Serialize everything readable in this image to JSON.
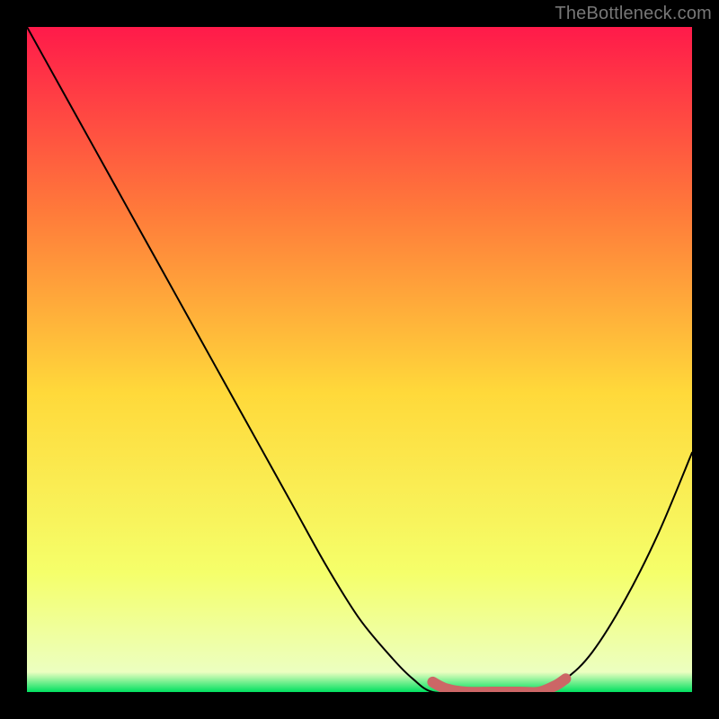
{
  "watermark": "TheBottleneck.com",
  "chart_data": {
    "type": "line",
    "title": "",
    "xlabel": "",
    "ylabel": "",
    "xlim": [
      0,
      1
    ],
    "ylim": [
      0,
      1
    ],
    "legend": false,
    "grid": false,
    "background_gradient": {
      "top": "#ff1a4a",
      "mid_upper": "#ff7b3a",
      "mid": "#ffd93a",
      "mid_lower": "#f5ff6a",
      "bottom": "#00e060"
    },
    "series": [
      {
        "name": "curve",
        "color": "#000000",
        "x": [
          0.0,
          0.05,
          0.1,
          0.15,
          0.2,
          0.25,
          0.3,
          0.35,
          0.4,
          0.45,
          0.5,
          0.55,
          0.58,
          0.61,
          0.66,
          0.72,
          0.77,
          0.81,
          0.85,
          0.9,
          0.95,
          1.0
        ],
        "y": [
          1.0,
          0.91,
          0.82,
          0.73,
          0.64,
          0.55,
          0.46,
          0.37,
          0.28,
          0.19,
          0.11,
          0.05,
          0.02,
          0.0,
          0.0,
          0.0,
          0.0,
          0.02,
          0.06,
          0.14,
          0.24,
          0.36
        ]
      }
    ],
    "highlight_segments": [
      {
        "name": "red-flat-segment",
        "color": "#cc6666",
        "x": [
          0.61,
          0.63,
          0.66,
          0.7,
          0.74,
          0.77,
          0.795,
          0.81
        ],
        "y": [
          0.015,
          0.005,
          0.0,
          0.0,
          0.0,
          0.0,
          0.01,
          0.02
        ]
      }
    ]
  }
}
